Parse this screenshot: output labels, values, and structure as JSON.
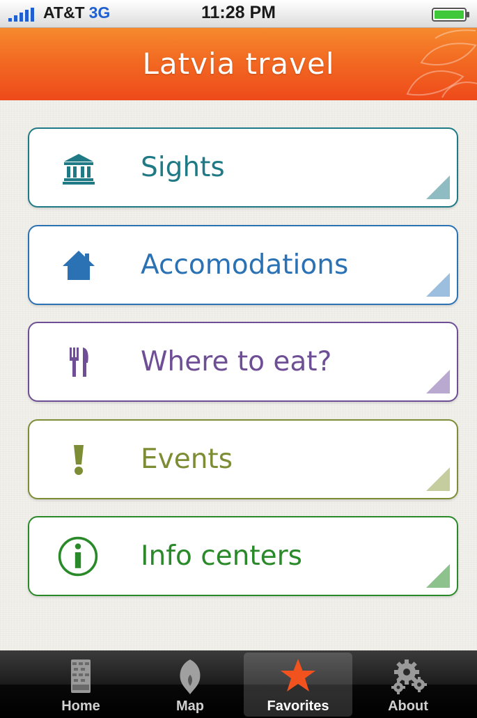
{
  "status_bar": {
    "carrier": "AT&T",
    "network": "3G",
    "time": "11:28 PM",
    "battery_icon": "battery-full-icon"
  },
  "header": {
    "title": "Latvia travel",
    "color": "#f26a22"
  },
  "menu": [
    {
      "label": "Sights",
      "icon": "bank-icon",
      "color": "#1f7a86"
    },
    {
      "label": "Accomodations",
      "icon": "house-icon",
      "color": "#2b72b5"
    },
    {
      "label": "Where to eat?",
      "icon": "fork-knife-icon",
      "color": "#6e4f95"
    },
    {
      "label": "Events",
      "icon": "exclamation-icon",
      "color": "#7d8d35"
    },
    {
      "label": "Info centers",
      "icon": "info-icon",
      "color": "#2a8a2a"
    }
  ],
  "tab_bar": {
    "tabs": [
      {
        "label": "Home",
        "icon": "home-pattern-icon"
      },
      {
        "label": "Map",
        "icon": "map-pin-icon"
      },
      {
        "label": "Favorites",
        "icon": "star-icon",
        "active": true
      },
      {
        "label": "About",
        "icon": "gears-icon"
      }
    ],
    "active_color": "#f26a22"
  }
}
